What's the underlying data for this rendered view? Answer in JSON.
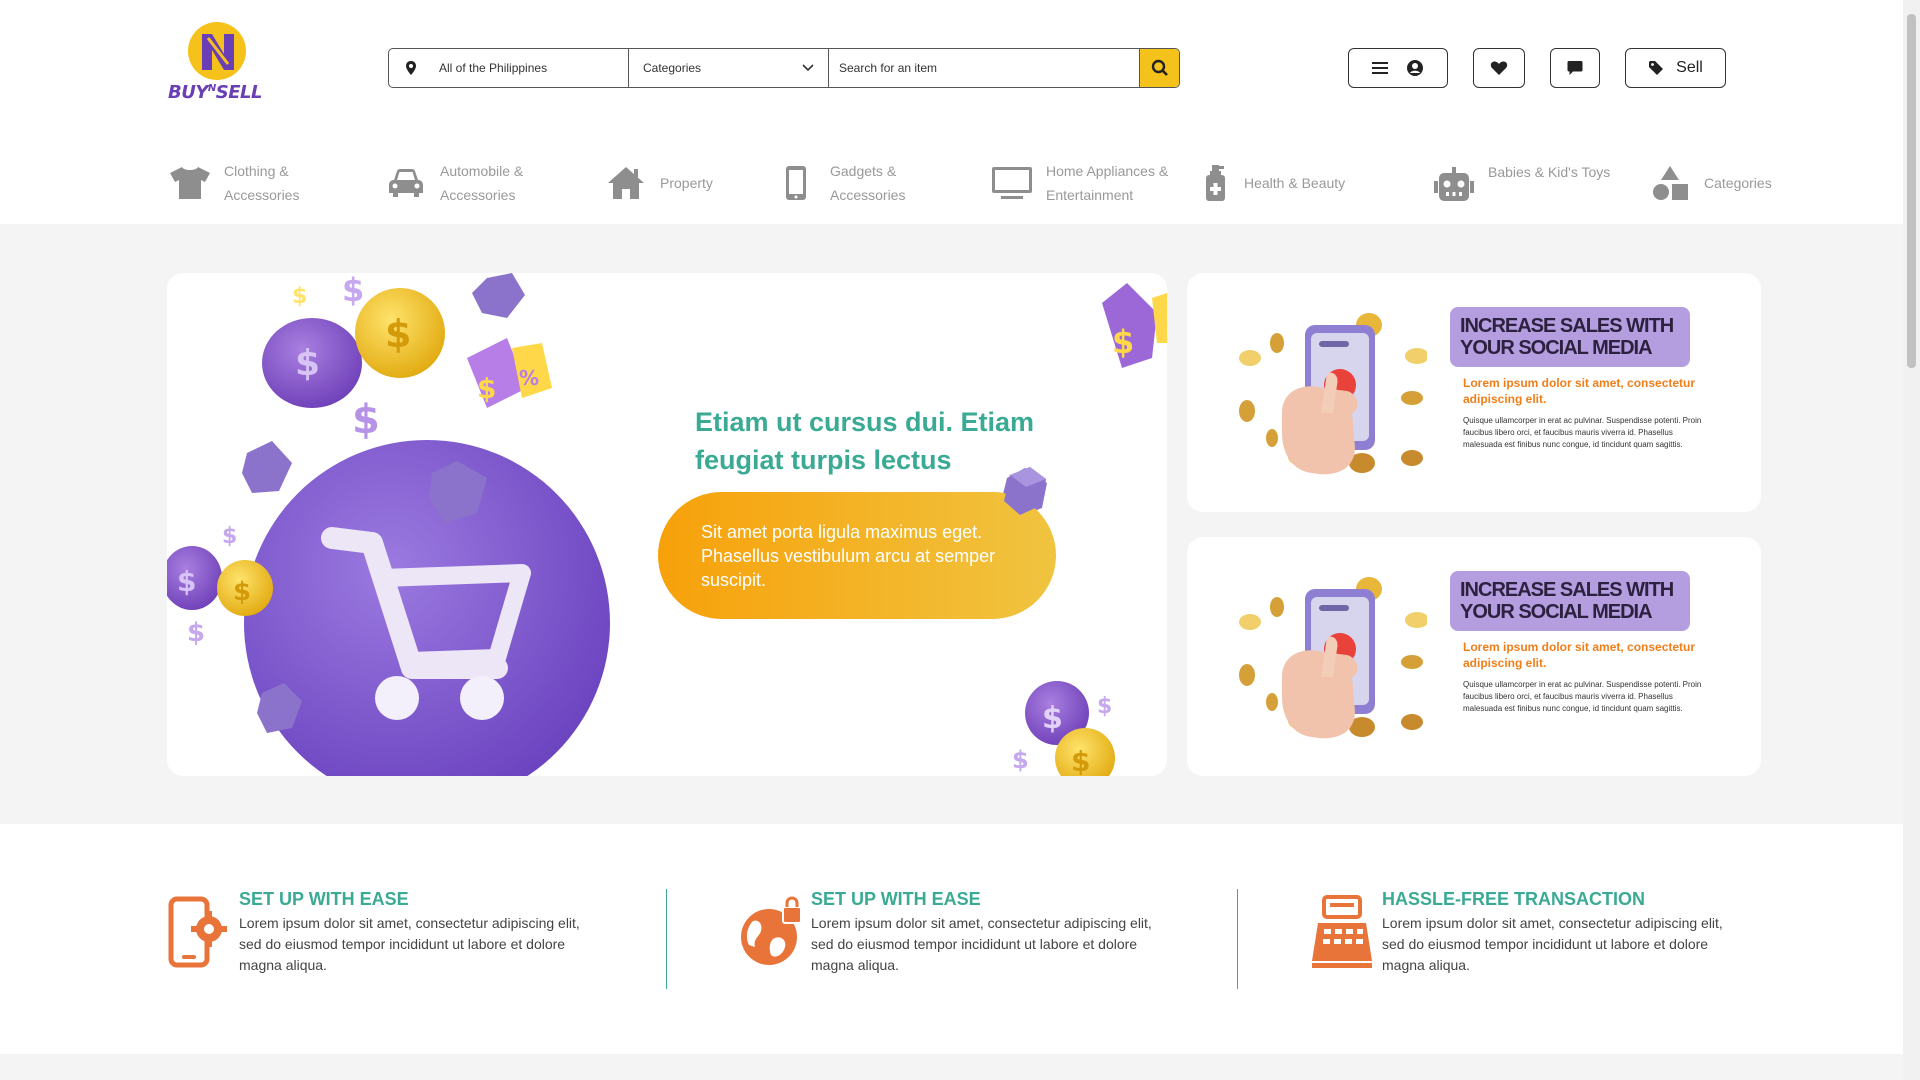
{
  "logo": {
    "text": "BUY",
    "sup": "N",
    "text2": "SELL"
  },
  "search": {
    "location": "All of the Philippines",
    "category": "Categories",
    "placeholder": "Search for an item"
  },
  "header_buttons": {
    "sell_label": "Sell"
  },
  "categories": [
    {
      "label": "Clothing &\nAccessories",
      "icon": "shirt-icon"
    },
    {
      "label": "Automobile &\nAccessories",
      "icon": "car-icon"
    },
    {
      "label": "Property",
      "icon": "house-icon"
    },
    {
      "label": "Gadgets &\nAccessories",
      "icon": "phone-icon"
    },
    {
      "label": "Home Appliances &\nEntertainment",
      "icon": "monitor-icon"
    },
    {
      "label": "Health & Beauty",
      "icon": "bottle-icon"
    },
    {
      "label": "Babies & Kid's Toys",
      "icon": "robot-icon"
    },
    {
      "label": "Categories",
      "icon": "shapes-icon"
    }
  ],
  "hero": {
    "title": "Etiam ut cursus dui. Etiam feugiat turpis lectus",
    "pill": "Sit amet porta ligula maximus eget. Phasellus vestibulum arcu at semper suscipit."
  },
  "promos": [
    {
      "badge": "INCREASE SALES WITH YOUR SOCIAL MEDIA",
      "sub": "Lorem ipsum dolor sit amet, consectetur adipiscing elit.",
      "body": "Quisque ullamcorper in erat ac pulvinar. Suspendisse potenti. Proin faucibus libero orci, et faucibus mauris viverra id. Phasellus malesuada est finibus nunc congue, id tincidunt quam sagittis."
    },
    {
      "badge": "INCREASE SALES WITH YOUR SOCIAL MEDIA",
      "sub": "Lorem ipsum dolor sit amet, consectetur adipiscing elit.",
      "body": "Quisque ullamcorper in erat ac pulvinar. Suspendisse potenti. Proin faucibus libero orci, et faucibus mauris viverra id. Phasellus malesuada est finibus nunc congue, id tincidunt quam sagittis."
    }
  ],
  "features": [
    {
      "title": "SET UP WITH EASE",
      "desc": "Lorem ipsum dolor sit amet, consectetur adipiscing elit, sed do eiusmod tempor incididunt ut labore et dolore magna aliqua.",
      "icon": "phone-gear-icon"
    },
    {
      "title": "SET UP WITH EASE",
      "desc": "Lorem ipsum dolor sit amet, consectetur adipiscing elit, sed do eiusmod tempor incididunt ut labore et dolore magna aliqua.",
      "icon": "globe-lock-icon"
    },
    {
      "title": "HASSLE-FREE TRANSACTION",
      "desc": "Lorem ipsum dolor sit amet, consectetur adipiscing elit, sed do eiusmod tempor incididunt ut labore et dolore magna aliqua.",
      "icon": "cash-register-icon"
    }
  ],
  "colors": {
    "accent": "#3aaa95",
    "brand_purple": "#6a3fb5",
    "brand_yellow": "#f5c21c",
    "orange": "#f07f1a"
  }
}
